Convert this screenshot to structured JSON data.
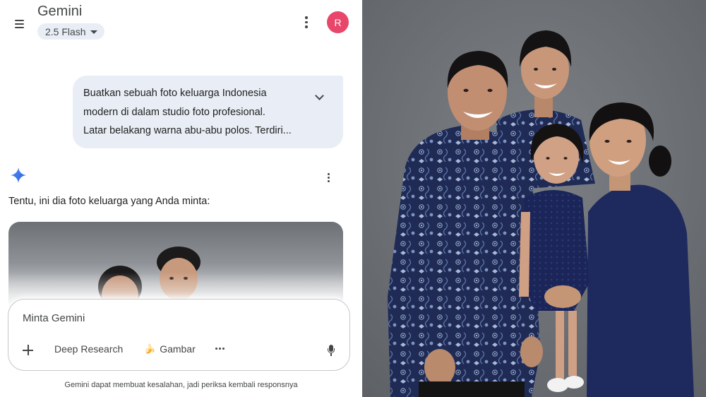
{
  "header": {
    "title": "Gemini",
    "model_label": "2.5 Flash",
    "avatar_initial": "R"
  },
  "conversation": {
    "user_prompt_lines": [
      "Buatkan sebuah foto keluarga Indonesia",
      "modern di dalam studio foto profesional.",
      "Latar belakang warna abu-abu polos. Terdiri..."
    ],
    "reply_text": "Tentu, ini dia foto keluarga yang Anda minta:"
  },
  "composer": {
    "placeholder": "Minta Gemini",
    "deep_research_label": "Deep Research",
    "gambar_label": "Gambar",
    "gambar_emoji": "🍌"
  },
  "footer": {
    "disclaimer": "Gemini dapat membuat kesalahan, jadi periksa kembali responsnya"
  },
  "colors": {
    "avatar": "#e8466b",
    "bubble": "#e9eef6",
    "spark_blue": "#4285f4",
    "background_gray": "#6f7378",
    "batik_navy": "#1e2a52"
  },
  "icons": [
    "menu-icon",
    "chevron-down-icon",
    "more-vert-icon",
    "gemini-spark-icon",
    "plus-icon",
    "more-horiz-icon",
    "mic-icon"
  ]
}
